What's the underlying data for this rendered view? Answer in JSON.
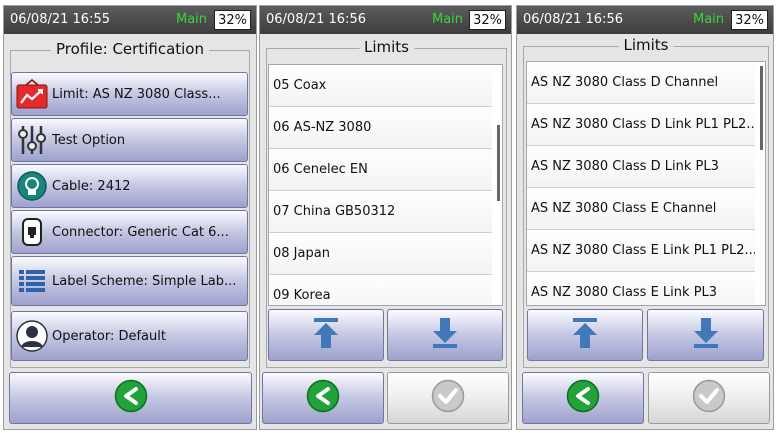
{
  "colors": {
    "accent_green": "#3ad43a",
    "button_lavender": "#c6c8e4",
    "arrow_blue": "#3f79b7"
  },
  "panel1": {
    "status": {
      "datetime": "06/08/21 16:55",
      "mode": "Main",
      "battery": "32%"
    },
    "title": "Profile: Certification",
    "options": [
      {
        "label": "Limit: AS NZ 3080 Class...",
        "icon": "limit-graph-icon"
      },
      {
        "label": "Test Option",
        "icon": "sliders-icon"
      },
      {
        "label": "Cable: 2412",
        "icon": "cable-icon"
      },
      {
        "label": "Connector: Generic Cat 6...",
        "icon": "connector-icon"
      },
      {
        "label": "Label Scheme: Simple Lab...",
        "icon": "list-icon"
      },
      {
        "label": "Operator: Default",
        "icon": "user-icon"
      }
    ]
  },
  "panel2": {
    "status": {
      "datetime": "06/08/21 16:56",
      "mode": "Main",
      "battery": "32%"
    },
    "title": "Limits",
    "items": [
      "05 Coax",
      "06 AS-NZ 3080",
      "06 Cenelec EN",
      "07 China GB50312",
      "08 Japan",
      "09 Korea"
    ]
  },
  "panel3": {
    "status": {
      "datetime": "06/08/21 16:56",
      "mode": "Main",
      "battery": "32%"
    },
    "title": "Limits",
    "items": [
      "AS NZ 3080 Class D Channel",
      "AS NZ 3080 Class D Link PL1 PL2...",
      "AS NZ 3080 Class D Link PL3",
      "AS NZ 3080 Class E Channel",
      "AS NZ 3080 Class E Link PL1 PL2...",
      "AS NZ 3080 Class E Link PL3"
    ]
  }
}
